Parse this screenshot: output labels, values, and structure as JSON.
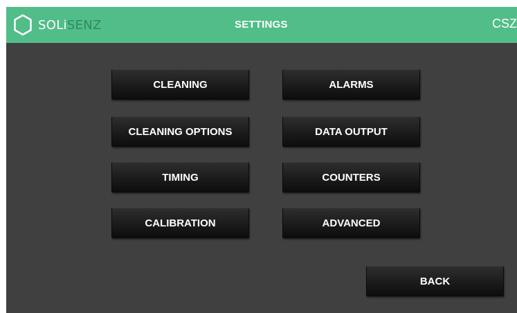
{
  "header": {
    "logo_text_light": "SOLi",
    "logo_text_accent": "SENZ",
    "title": "SETTINGS",
    "device_label": "CSZ",
    "background_color": "#51bd89"
  },
  "menu": {
    "cleaning": "CLEANING",
    "alarms": "ALARMS",
    "cleaning_options": "CLEANING OPTIONS",
    "data_output": "DATA OUTPUT",
    "timing": "TIMING",
    "counters": "COUNTERS",
    "calibration": "CALIBRATION",
    "advanced": "ADVANCED"
  },
  "footer": {
    "back": "BACK"
  },
  "colors": {
    "panel_background": "#404040",
    "button_background": "#1b1b1b",
    "text": "#ffffff"
  }
}
